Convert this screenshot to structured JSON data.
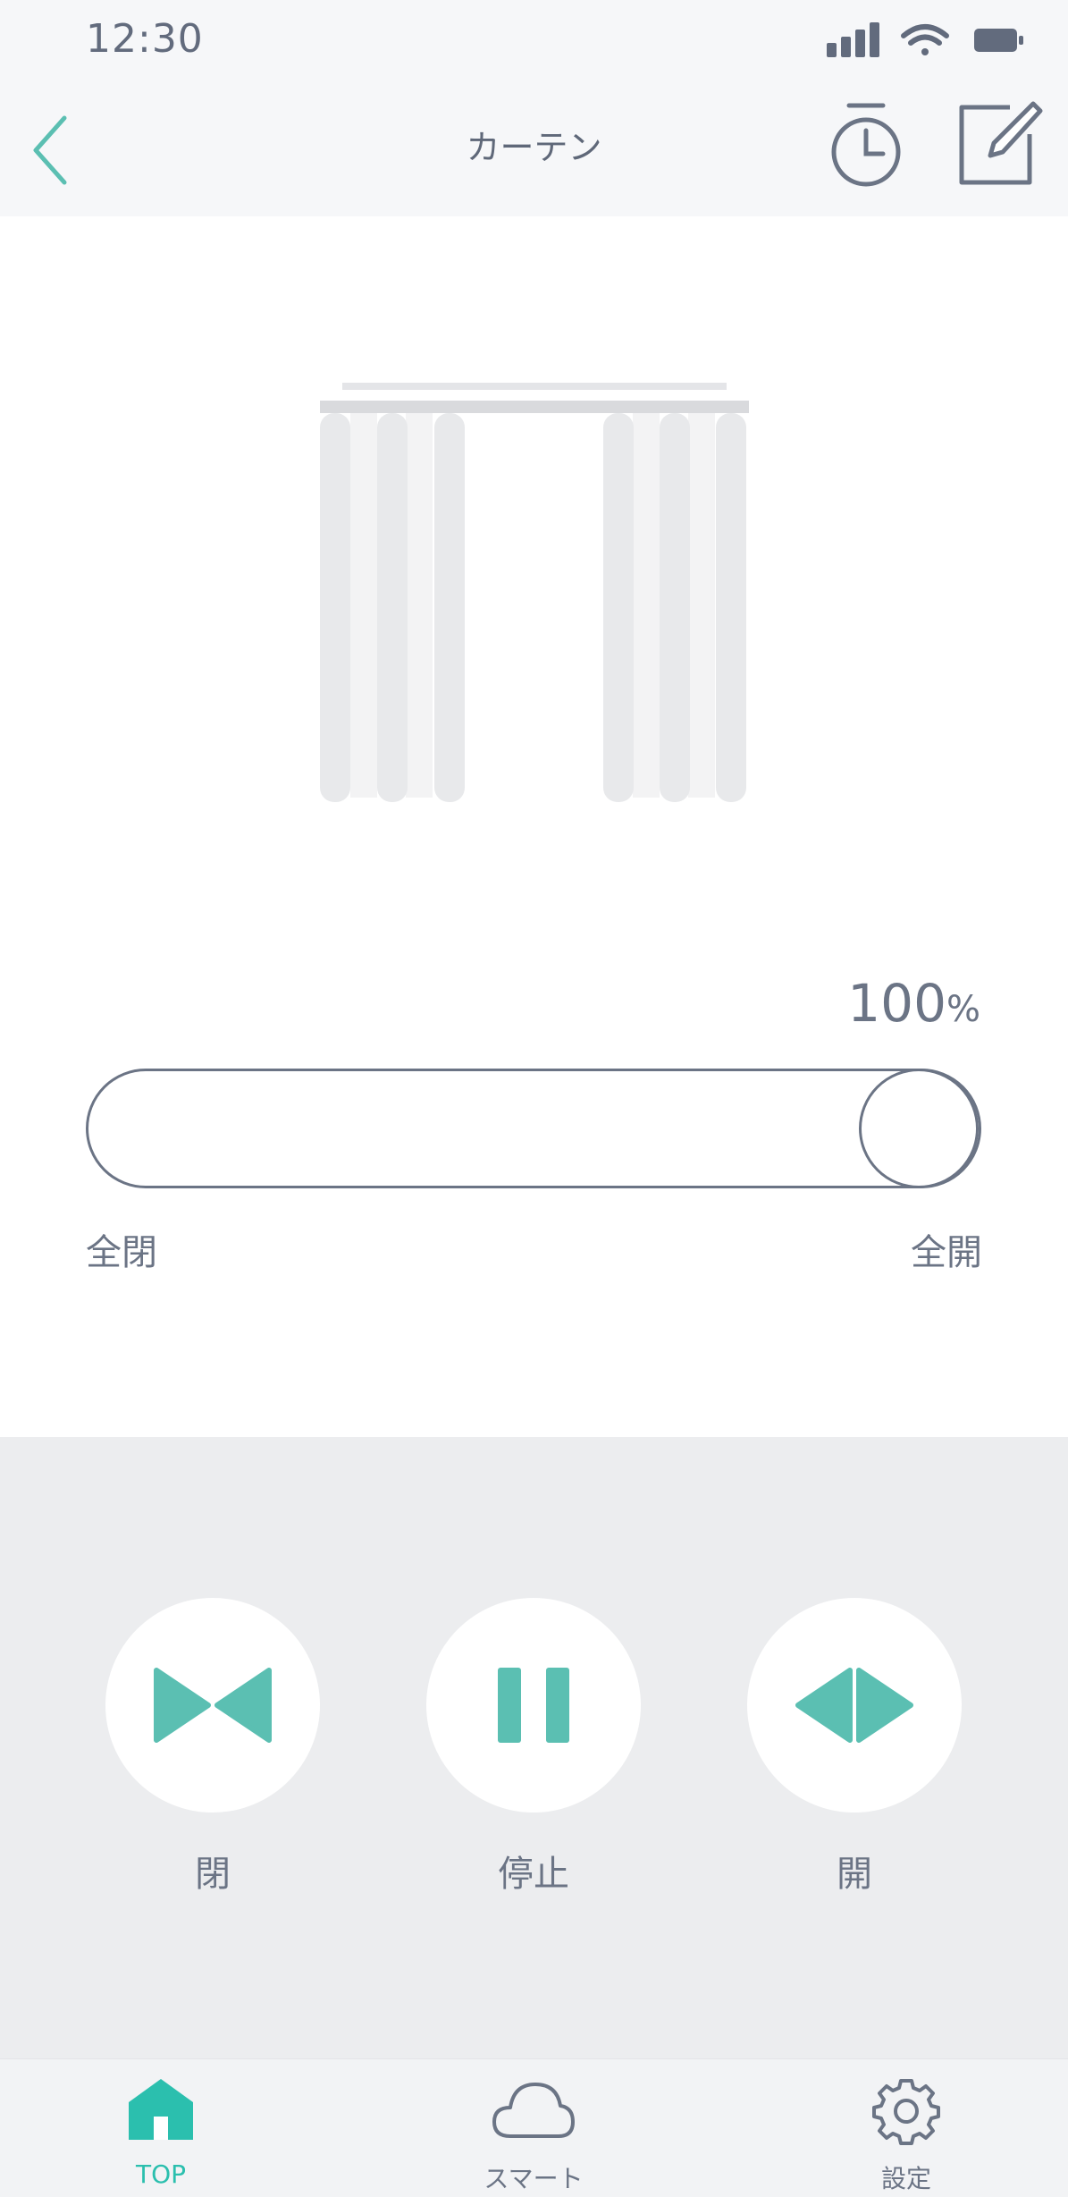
{
  "status_bar": {
    "time": "12:30"
  },
  "nav": {
    "title": "カーテン"
  },
  "position": {
    "value": "100",
    "unit": "%",
    "level": 1.0,
    "min_label": "全閉",
    "max_label": "全開"
  },
  "controls": [
    {
      "label": "閉",
      "icon": "close-curtain-icon"
    },
    {
      "label": "停止",
      "icon": "pause-icon"
    },
    {
      "label": "開",
      "icon": "open-curtain-icon"
    }
  ],
  "tabs": [
    {
      "label": "TOP",
      "icon": "home-icon",
      "active": true
    },
    {
      "label": "スマート",
      "icon": "cloud-icon",
      "active": false
    },
    {
      "label": "設定",
      "icon": "gear-icon",
      "active": false
    }
  ],
  "colors": {
    "accent": "#5bbfb2",
    "text": "#6b7485",
    "control_bg": "#ecedef",
    "curtain": "#e8e9eb"
  }
}
